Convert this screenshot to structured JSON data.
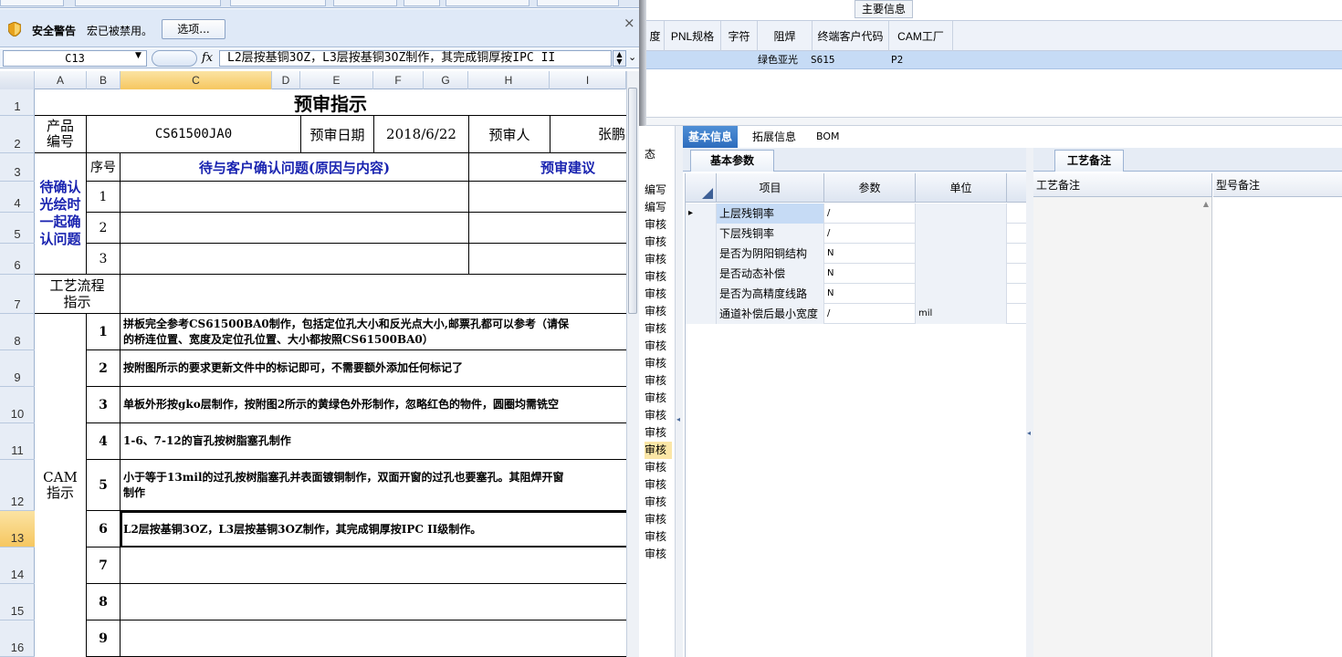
{
  "security_bar": {
    "title": "安全警告",
    "message": "宏已被禁用。",
    "options_button": "选项...",
    "close": "×"
  },
  "formula_bar": {
    "name_box": "C13",
    "fx": "fx",
    "formula": "L2层按基铜3OZ，L3层按基铜3OZ制作，其完成铜厚按IPC II"
  },
  "columns": [
    "A",
    "B",
    "C",
    "D",
    "E",
    "F",
    "G",
    "H",
    "I"
  ],
  "rows": [
    "1",
    "2",
    "3",
    "4",
    "5",
    "6",
    "7",
    "8",
    "9",
    "10",
    "11",
    "12",
    "13",
    "14",
    "15",
    "16"
  ],
  "sheet": {
    "title": "预审指示",
    "product_no_label": "产品\n编号",
    "product_no": "CS61500JA0",
    "review_date_label": "预审日期",
    "review_date": "2018/6/22",
    "reviewer_label": "预审人",
    "reviewer": "张鹏",
    "confirm_label": "待确认\n光绘时\n一起确\n认问题",
    "seq_label": "序号",
    "issue_header": "待与客户确认问题(原因与内容)",
    "suggestion_header": "预审建议",
    "confirm_nums": [
      "1",
      "2",
      "3"
    ],
    "process_label": "工艺流程\n指示",
    "cam_label": "CAM\n指示",
    "cam_nums": [
      "1",
      "2",
      "3",
      "4",
      "5",
      "6",
      "7",
      "8",
      "9"
    ],
    "cam_steps": [
      "拼板完全参考CS61500BA0制作，包括定位孔大小和反光点大小,邮票孔都可以参考（请保\n的桥连位置、宽度及定位孔位置、大小都按照CS61500BA0）",
      "按附图所示的要求更新文件中的标记即可，不需要额外添加任何标记了",
      "单板外形按gko层制作，按附图2所示的黄绿色外形制作，忽略红色的物件，圆圈均需铣空",
      "1-6、7-12的盲孔按树脂塞孔制作",
      "小于等于13mil的过孔按树脂塞孔并表面镀铜制作，双面开窗的过孔也要塞孔。其阻焊开窗\n制作",
      "L2层按基铜3OZ，L3层按基铜3OZ制作，其完成铜厚按IPC II级制作。",
      "",
      "",
      ""
    ]
  },
  "app": {
    "main_info": "主要信息",
    "grid_headers": [
      "度",
      "PNL规格",
      "字符",
      "阻焊",
      "终端客户代码",
      "CAM工厂"
    ],
    "grid_row": {
      "solder": "绿色亚光",
      "code": "S615",
      "factory": "P2"
    },
    "audit_items": [
      "编写",
      "编写",
      "审核",
      "审核",
      "审核",
      "审核",
      "审核",
      "审核",
      "审核",
      "审核",
      "审核",
      "审核",
      "审核",
      "审核",
      "审核",
      "审核",
      "审核",
      "审核",
      "审核",
      "审核",
      "审核",
      "审核"
    ],
    "audit_status_label": "态",
    "tabs": [
      "基本信息",
      "拓展信息",
      "BOM"
    ],
    "basic_params_tab": "基本参数",
    "param_headers": [
      "项目",
      "参数",
      "单位"
    ],
    "params": [
      {
        "item": "上层残铜率",
        "param": "/",
        "unit": ""
      },
      {
        "item": "下层残铜率",
        "param": "/",
        "unit": ""
      },
      {
        "item": "是否为阴阳铜结构",
        "param": "N",
        "unit": ""
      },
      {
        "item": "是否动态补偿",
        "param": "N",
        "unit": ""
      },
      {
        "item": "是否为高精度线路",
        "param": "N",
        "unit": ""
      },
      {
        "item": "通道补偿后最小宽度",
        "param": "/",
        "unit": "mil"
      }
    ],
    "craft_tab": "工艺备注",
    "craft_note_header": "工艺备注",
    "model_note_header": "型号备注"
  },
  "colors": {
    "accent": "#2d6cbd",
    "selection": "#c6dbf5",
    "blue_text": "#1a24b0",
    "header_highlight": "#f6c760"
  }
}
